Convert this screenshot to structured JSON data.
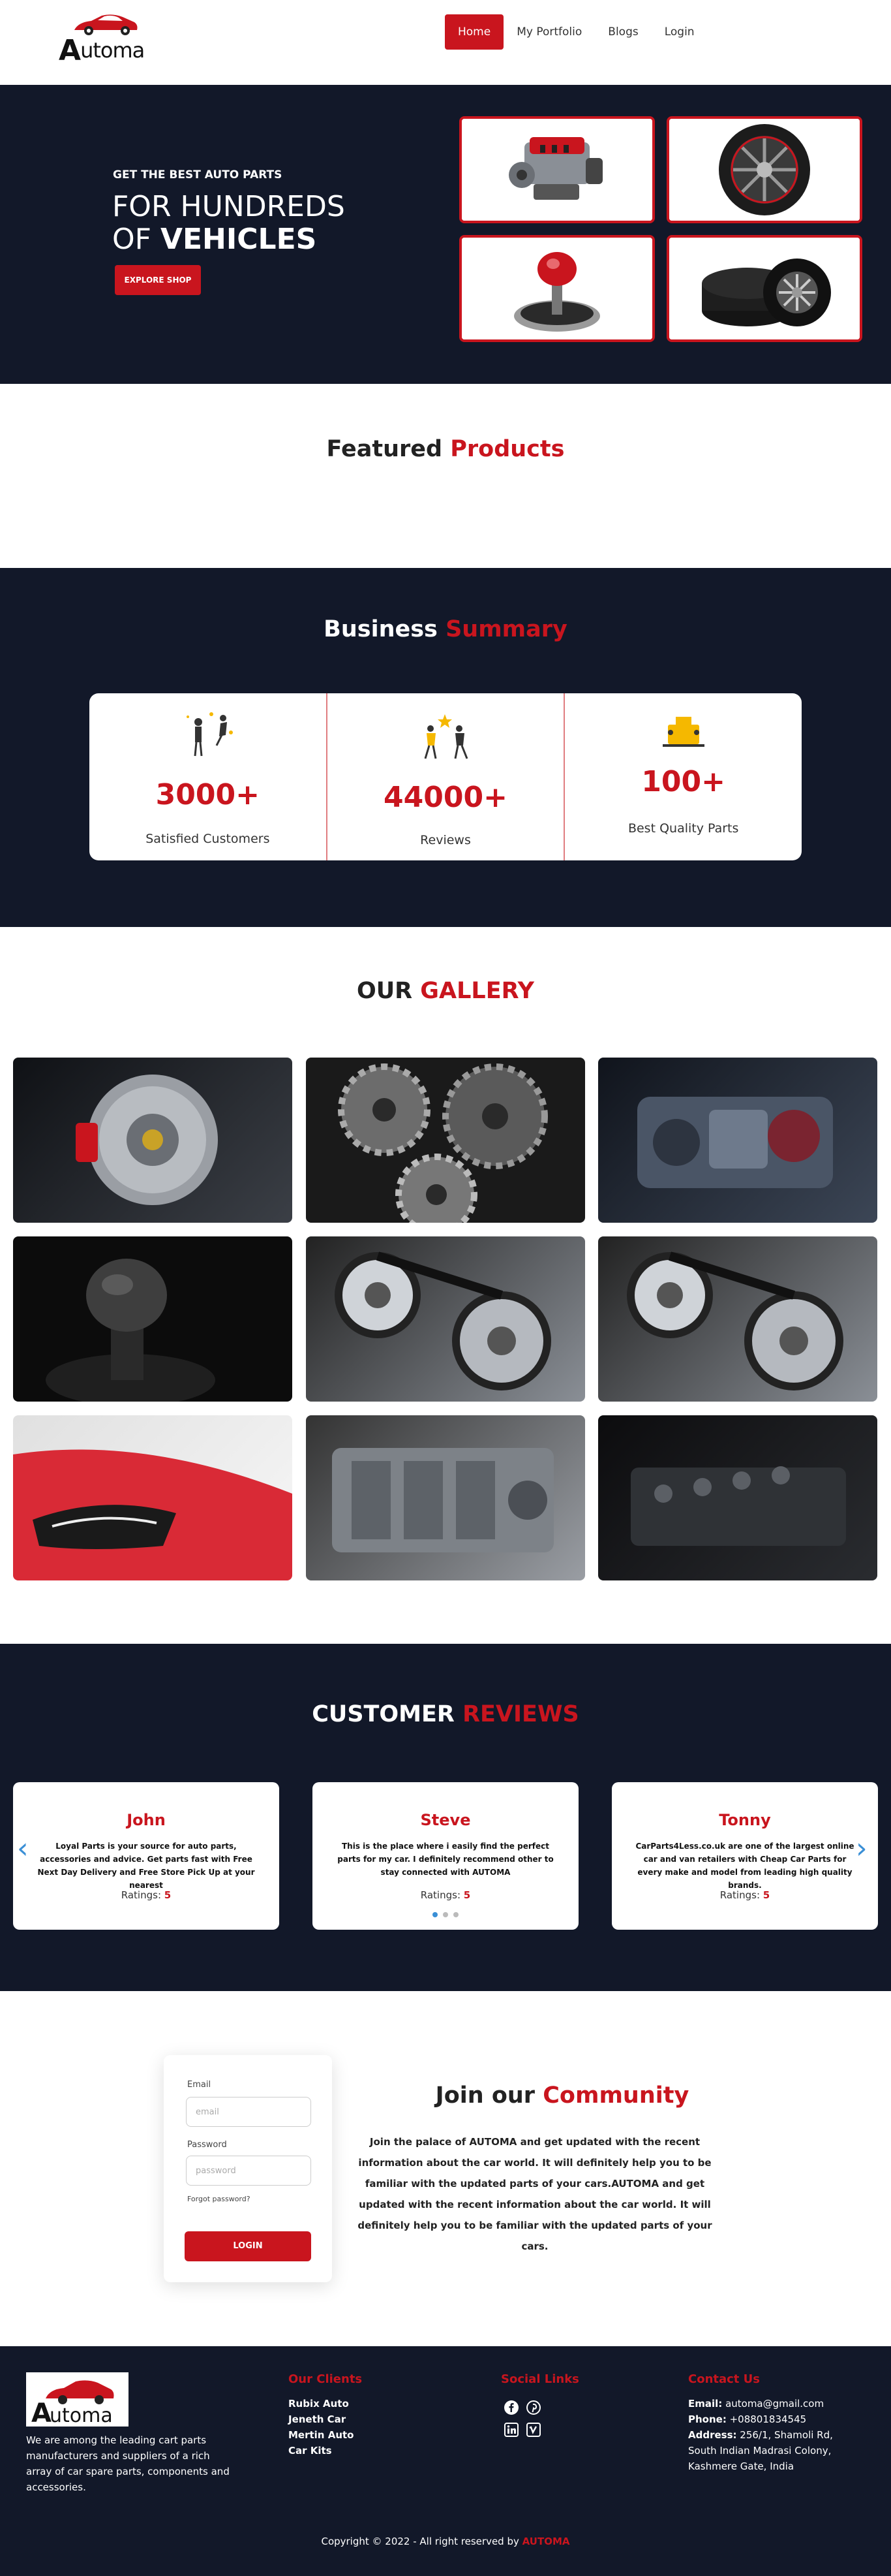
{
  "brand": {
    "name": "Automa",
    "accent": "#c9151e",
    "dark": "#121829"
  },
  "nav": {
    "items": [
      {
        "label": "Home",
        "active": true
      },
      {
        "label": "My Portfolio",
        "active": false
      },
      {
        "label": "Blogs",
        "active": false
      },
      {
        "label": "Login",
        "active": false
      }
    ]
  },
  "hero": {
    "kicker": "GET THE BEST AUTO PARTS",
    "line1": "FOR HUNDREDS",
    "line2_prefix": "OF ",
    "line2_bold": "VEHICLES",
    "button": "EXPLORE SHOP"
  },
  "featured": {
    "title_a": "Featured",
    "title_b": "Products"
  },
  "business": {
    "title_a": "Business",
    "title_b": "Summary",
    "stats": [
      {
        "number": "3000+",
        "label": "Satisfied Customers"
      },
      {
        "number": "44000+",
        "label": "Reviews"
      },
      {
        "number": "100+",
        "label": "Best Quality Parts"
      }
    ]
  },
  "gallery": {
    "title_a": "OUR",
    "title_b": "GALLERY"
  },
  "reviews": {
    "title_a": "CUSTOMER",
    "title_b": "REVIEWS",
    "rating_label": "Ratings:",
    "items": [
      {
        "name": "John",
        "text": "Loyal Parts is your source for auto parts, accessories and advice. Get parts fast with Free Next Day Delivery and Free Store Pick Up at your nearest",
        "rating": "5"
      },
      {
        "name": "Steve",
        "text": "This is the place where i easily find the perfect parts for my car. I definitely recommend other to stay connected with AUTOMA",
        "rating": "5"
      },
      {
        "name": "Tonny",
        "text": "CarParts4Less.co.uk are one of the largest online car and van retailers with Cheap Car Parts for every make and model from leading high quality brands.",
        "rating": "5"
      }
    ],
    "prev_icon": "‹",
    "next_icon": "›"
  },
  "login": {
    "email_label": "Email",
    "email_placeholder": "email",
    "password_label": "Password",
    "password_placeholder": "password",
    "forgot": "Forgot password?",
    "button": "LOGIN"
  },
  "community": {
    "title_a": "Join our",
    "title_b": "Community",
    "text": "Join the palace of AUTOMA and get updated with the recent information about the car world. It will definitely help you to be familiar with the updated parts of your cars.AUTOMA and get updated with the recent information about the car world. It will definitely help you to be familiar with the updated parts of your cars."
  },
  "footer": {
    "about": "We are among the leading cart parts manufacturers and suppliers of a rich array of car spare parts, components and accessories.",
    "clients_title": "Our Clients",
    "clients": [
      "Rubix Auto",
      "Jeneth Car",
      "Mertin Auto",
      "Car Kits"
    ],
    "social_title": "Social Links",
    "social_icons": [
      "facebook-icon",
      "pinterest-icon",
      "linkedin-icon",
      "vimeo-icon"
    ],
    "contact_title": "Contact Us",
    "email_label": "Email:",
    "email": "automa@gmail.com",
    "phone_label": "Phone:",
    "phone": "+08801834545",
    "address_label": "Address:",
    "address": "256/1, Shamoli Rd, South Indian Madrasi Colony, Kashmere Gate, India",
    "copyright_prefix": "Copyright © 2022 - All right reserved by",
    "copyright_brand": "AUTOMA"
  }
}
